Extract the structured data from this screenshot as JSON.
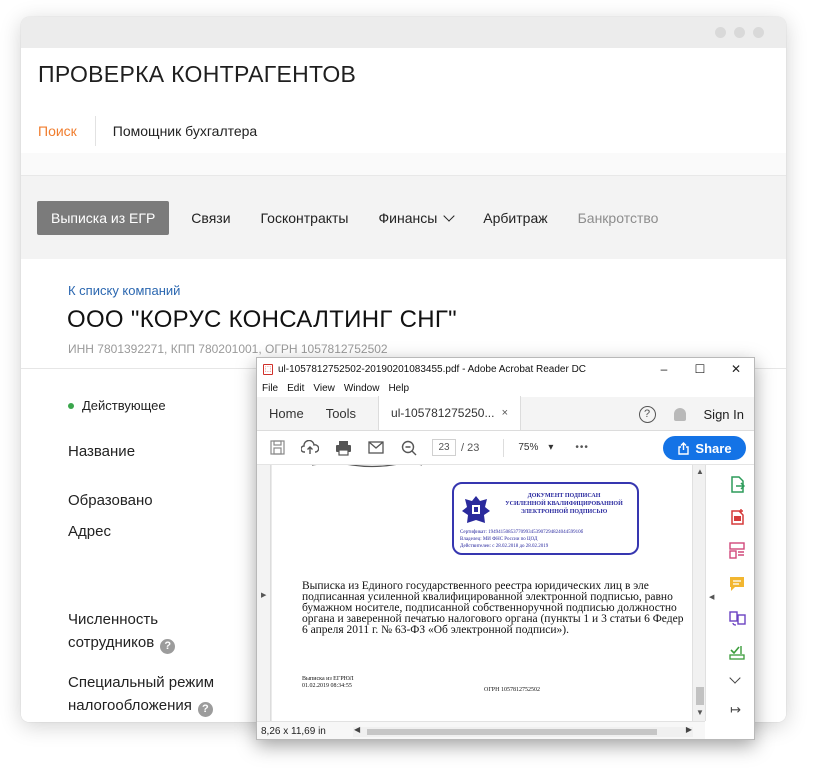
{
  "site": {
    "app_title": "ПРОВЕРКА КОНТРАГЕНТОВ",
    "subnav": {
      "active": "Поиск",
      "other": "Помощник бухгалтера"
    },
    "tabs": [
      {
        "label": "Выписка из ЕГР"
      },
      {
        "label": "Связи"
      },
      {
        "label": "Госконтракты"
      },
      {
        "label": "Финансы"
      },
      {
        "label": "Арбитраж"
      },
      {
        "label": "Банкротство"
      }
    ],
    "back_link": "К списку компаний",
    "company_name": "ООО \"КОРУС КОНСАЛТИНГ СНГ\"",
    "requisites": "ИНН 7801392271, КПП 780201001, ОГРН 1057812752502",
    "status": "Действующее",
    "fields": {
      "name": "Название",
      "founded": "Образовано",
      "address": "Адрес",
      "staff_line1": "Численность",
      "staff_line2": "сотрудников",
      "tax_line1": "Специальный режим",
      "tax_line2": "налогообложения"
    },
    "colors": {
      "accent": "#f07d2e",
      "link": "#2b67b0",
      "status_green": "#3aa64c",
      "active_tab": "#7b7b7b"
    }
  },
  "acrobat": {
    "window_title": "ul-1057812752502-20190201083455.pdf - Adobe Acrobat Reader DC",
    "window_controls": {
      "min": "–",
      "max": "☐",
      "close": "✕"
    },
    "menu": [
      "File",
      "Edit",
      "View",
      "Window",
      "Help"
    ],
    "tabs": {
      "home": "Home",
      "tools": "Tools",
      "doc": "ul-105781275250...",
      "doc_close": "×"
    },
    "sign_in": "Sign In",
    "help_glyph": "?",
    "page_current": "23",
    "page_total": "/ 23",
    "zoom": "75%",
    "zoom_caret": "▾",
    "more": "•••",
    "share": "Share",
    "page_size": "8,26 x 11,69 in",
    "colors": {
      "share_blue": "#1473e6",
      "stamp_blue": "#3636b0"
    },
    "document": {
      "stamp_title": [
        "ДОКУМЕНТ ПОДПИСАН",
        "УСИЛЕННОЙ КВАЛИФИЦИРОВАННОЙ",
        "ЭЛЕКТРОННОЙ ПОДПИСЬЮ"
      ],
      "stamp_details": [
        "Сертификат: 1949415085377099345390729482404459910б",
        "Владелец: МИ ФНС России по ЦОД",
        "Действителен: с 28.02.2018 до 28.02.2019"
      ],
      "paragraph": [
        "Выписка из Единого государственного реестра юридических лиц в эле",
        "подписанная усиленной квалифицированной электронной подписью, равно",
        "бумажном носителе, подписанной собственноручной подписью должностно",
        "органа и заверенной печатью налогового органа (пункты 1 и 3 статьи 6 Федер",
        "6 апреля 2011 г. № 63-ФЗ «Об электронной подписи»)."
      ],
      "footer_left": [
        "Выписка из ЕГРЮЛ",
        "01.02.2019 08:34:55"
      ],
      "footer_right": "ОГРН 1057812752502"
    }
  }
}
